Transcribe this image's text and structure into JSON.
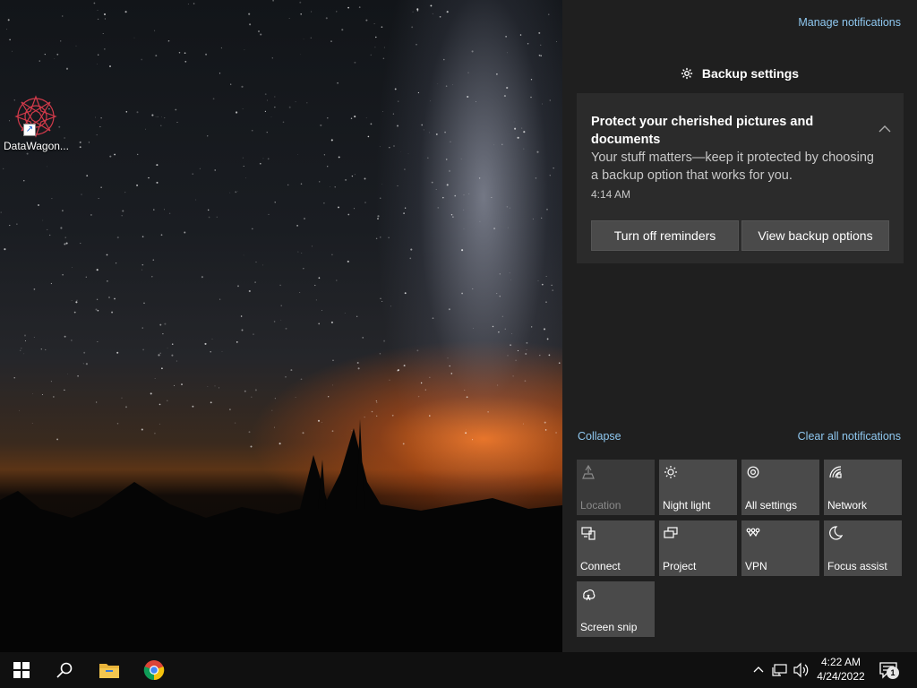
{
  "desktop": {
    "icon_label": "DataWagon..."
  },
  "action_center": {
    "manage_link": "Manage notifications",
    "group_title": "Backup settings",
    "notification": {
      "title": "Protect your cherished pictures and documents",
      "body": "Your stuff matters—keep it protected by choosing a backup option that works for you.",
      "time": "4:14 AM",
      "buttons": [
        "Turn off reminders",
        "View backup options"
      ]
    },
    "collapse_link": "Collapse",
    "clear_link": "Clear all notifications",
    "quick_actions": [
      {
        "label": "Location",
        "icon": "location-icon",
        "enabled": false
      },
      {
        "label": "Night light",
        "icon": "night-light-icon",
        "enabled": true
      },
      {
        "label": "All settings",
        "icon": "gear-icon",
        "enabled": true
      },
      {
        "label": "Network",
        "icon": "network-icon",
        "enabled": true
      },
      {
        "label": "Connect",
        "icon": "connect-icon",
        "enabled": true
      },
      {
        "label": "Project",
        "icon": "project-icon",
        "enabled": true
      },
      {
        "label": "VPN",
        "icon": "vpn-icon",
        "enabled": true
      },
      {
        "label": "Focus assist",
        "icon": "moon-icon",
        "enabled": true
      },
      {
        "label": "Screen snip",
        "icon": "screen-snip-icon",
        "enabled": true
      }
    ]
  },
  "taskbar": {
    "time": "4:22 AM",
    "date": "4/24/2022",
    "notification_count": "1"
  },
  "colors": {
    "link": "#8fc8f0",
    "panel_bg": "#1f1f1f",
    "card_bg": "#2b2b2b",
    "tile_bg": "#4a4a4a",
    "taskbar_bg": "#101010"
  }
}
